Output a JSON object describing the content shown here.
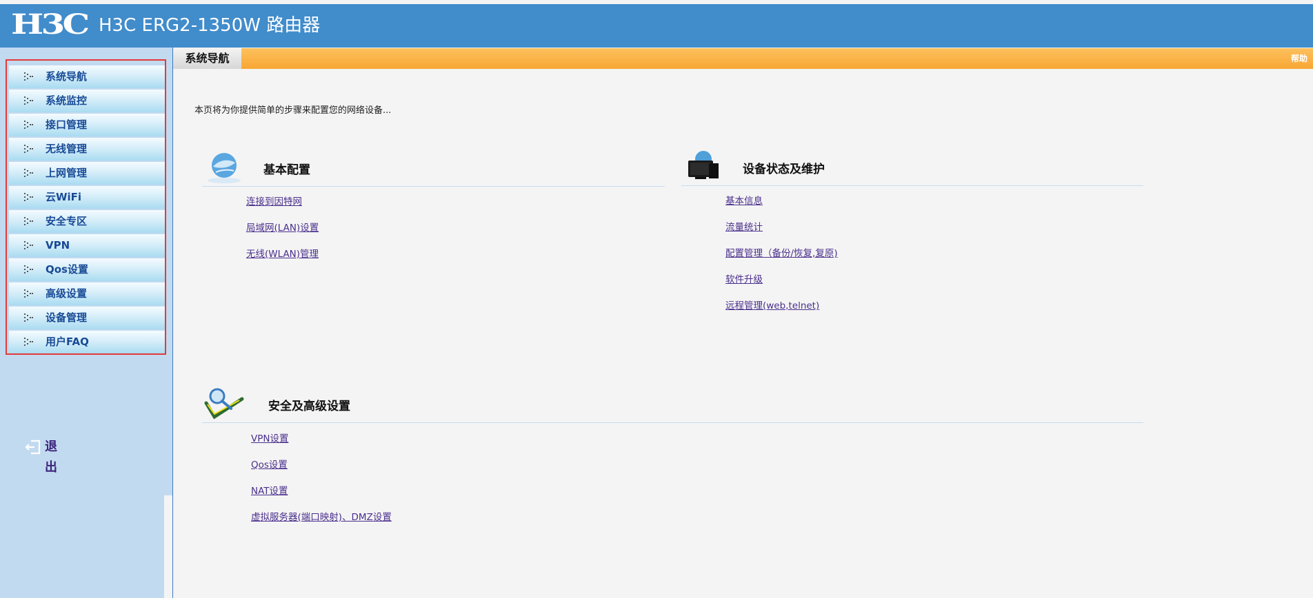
{
  "header": {
    "logo_text": "H3C",
    "title": "H3C ERG2-1350W 路由器",
    "bg_color": "#418ccb"
  },
  "sidebar": {
    "items": [
      {
        "label": "系统导航",
        "icon": "arrow-icon"
      },
      {
        "label": "系统监控",
        "icon": "arrow-icon"
      },
      {
        "label": "接口管理",
        "icon": "arrow-icon"
      },
      {
        "label": "无线管理",
        "icon": "arrow-icon"
      },
      {
        "label": "上网管理",
        "icon": "arrow-icon"
      },
      {
        "label": "云WiFi",
        "icon": "arrow-icon"
      },
      {
        "label": "安全专区",
        "icon": "arrow-icon"
      },
      {
        "label": "VPN",
        "icon": "arrow-icon"
      },
      {
        "label": "Qos设置",
        "icon": "arrow-icon"
      },
      {
        "label": "高级设置",
        "icon": "arrow-icon"
      },
      {
        "label": "设备管理",
        "icon": "arrow-icon"
      },
      {
        "label": "用户FAQ",
        "icon": "arrow-icon"
      }
    ],
    "logout": {
      "label": "退出",
      "icon": "logout-icon"
    },
    "highlight_color": "#e53935"
  },
  "tabbar": {
    "active_tab": "系统导航",
    "help_label": "帮助",
    "accent_color": "#f8a733"
  },
  "main": {
    "intro": "本页将为你提供简单的步骤来配置您的网络设备...",
    "sections": {
      "basic": {
        "title": "基本配置",
        "icon": "globe-icon",
        "links": [
          "连接到因特网",
          "局域网(LAN)设置",
          "无线(WLAN)管理"
        ]
      },
      "status": {
        "title": "设备状态及维护",
        "icon": "monitor-icon",
        "links": [
          "基本信息",
          "流量统计",
          "配置管理（备份/恢复,复原)",
          "软件升级",
          "远程管理(web,telnet)"
        ]
      },
      "security": {
        "title": "安全及高级设置",
        "icon": "magnifier-check-icon",
        "links": [
          "VPN设置",
          "Qos设置",
          "NAT设置",
          "虚拟服务器(端口映射)、DMZ设置"
        ]
      }
    }
  }
}
